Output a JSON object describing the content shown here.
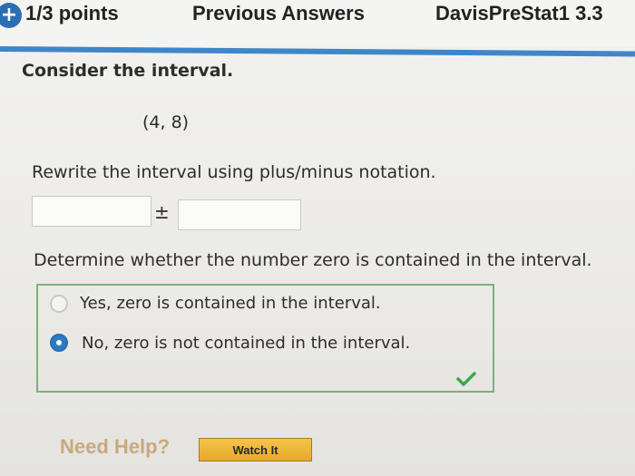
{
  "header": {
    "points": "1/3 points",
    "previous_answers": "Previous Answers",
    "course": "DavisPreStat1 3.3"
  },
  "question": {
    "prompt": "Consider the interval.",
    "interval": "(4, 8)",
    "rewrite_prompt": "Rewrite the interval using plus/minus notation.",
    "center_value": "",
    "plusminus_symbol": "±",
    "radius_value": "",
    "zero_prompt": "Determine whether the number zero is contained in the interval."
  },
  "choices": [
    {
      "label": "Yes, zero is contained in the interval.",
      "selected": false
    },
    {
      "label": "No, zero is not contained in the interval.",
      "selected": true
    }
  ],
  "status": {
    "correct": true,
    "icon": "checkmark-icon",
    "color": "#3ea84a"
  },
  "help": {
    "label": "Need Help?",
    "watch_button": "Watch It"
  },
  "colors": {
    "accent_blue": "#3f86c9",
    "radio_selected": "#2d7cc3",
    "watch_button": "#f0b93a"
  }
}
